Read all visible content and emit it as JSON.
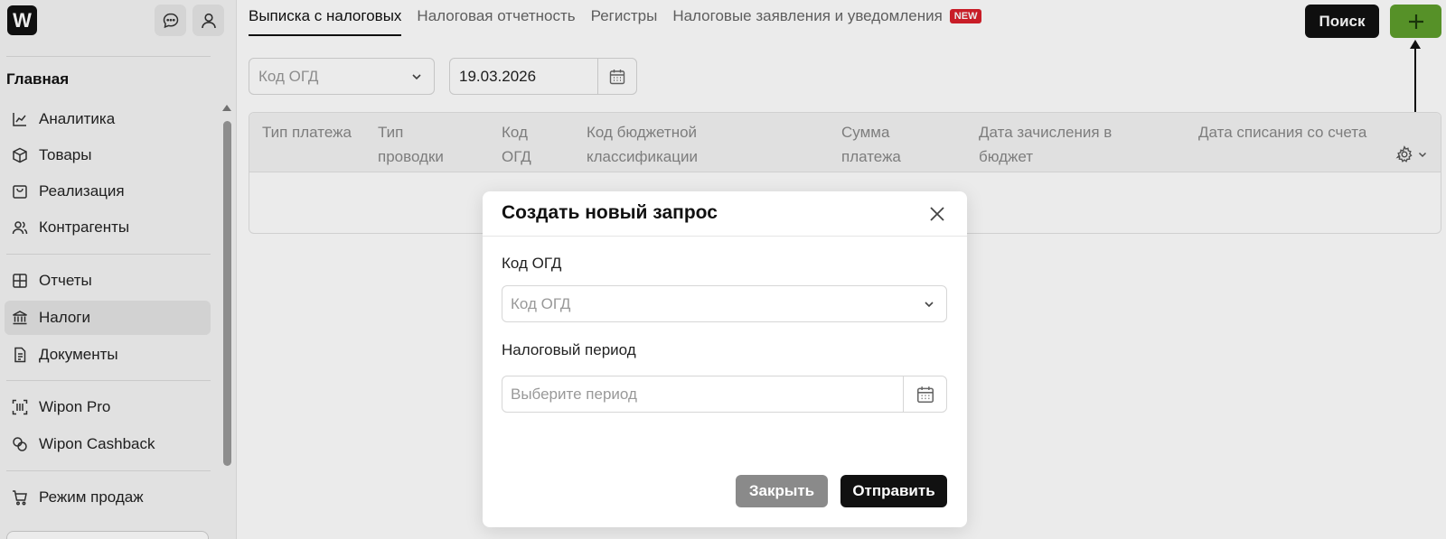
{
  "sidebar": {
    "logo_letter": "W",
    "heading": "Главная",
    "items": [
      {
        "label": "Аналитика",
        "icon": "chart-icon"
      },
      {
        "label": "Товары",
        "icon": "box-icon"
      },
      {
        "label": "Реализация",
        "icon": "bag-icon"
      },
      {
        "label": "Контрагенты",
        "icon": "users-icon"
      },
      {
        "label": "Отчеты",
        "icon": "grid-icon"
      },
      {
        "label": "Налоги",
        "icon": "bank-icon",
        "active": true
      },
      {
        "label": "Документы",
        "icon": "document-icon"
      },
      {
        "label": "Wipon Pro",
        "icon": "barcode-scan-icon"
      },
      {
        "label": "Wipon Cashback",
        "icon": "coins-icon"
      },
      {
        "label": "Режим продаж",
        "icon": "cart-icon"
      }
    ]
  },
  "tabs": [
    {
      "label": "Выписка с налоговых",
      "active": true
    },
    {
      "label": "Налоговая отчетность"
    },
    {
      "label": "Регистры"
    },
    {
      "label": "Налоговые заявления и уведомления",
      "badge": "NEW"
    }
  ],
  "header": {
    "search_label": "Поиск"
  },
  "filters": {
    "ogd_placeholder": "Код ОГД",
    "date_value": "19.03.2026"
  },
  "table": {
    "columns": [
      "Тип платежа",
      "Тип проводки",
      "Код ОГД",
      "Код бюджетной классификации",
      "Сумма платежа",
      "Дата зачисления в бюджет",
      "Дата списания со счета"
    ]
  },
  "modal": {
    "title": "Создать новый запрос",
    "ogd_label": "Код ОГД",
    "ogd_placeholder": "Код ОГД",
    "period_label": "Налоговый период",
    "period_placeholder": "Выберите период",
    "close_label": "Закрыть",
    "send_label": "Отправить"
  },
  "colors": {
    "accent_green": "#5e9e2c",
    "badge_red": "#d9202b",
    "dark": "#111111"
  }
}
